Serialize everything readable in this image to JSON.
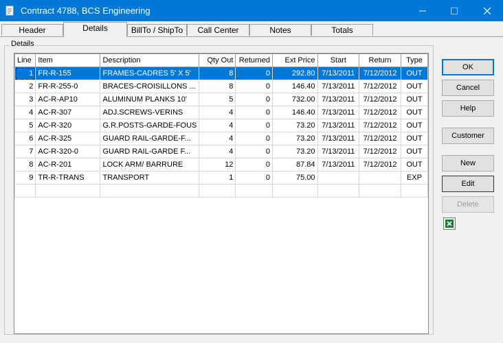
{
  "window": {
    "title": "Contract 4788, BCS Engineering"
  },
  "tabs": [
    {
      "label": "Header",
      "active": false
    },
    {
      "label": "Details",
      "active": true
    },
    {
      "label": "BillTo / ShipTo",
      "active": false
    },
    {
      "label": "Call Center",
      "active": false
    },
    {
      "label": "Notes",
      "active": false
    },
    {
      "label": "Totals",
      "active": false
    }
  ],
  "details": {
    "group_label": "Details",
    "columns": [
      "Line",
      "Item",
      "Description",
      "Qty Out",
      "Returned",
      "Ext Price",
      "Start",
      "Return",
      "Type"
    ],
    "rows": [
      [
        "1",
        "FR-R-155",
        "FRAMES-CADRES  5' X 5'",
        "8",
        "0",
        "292.80",
        "7/13/2011",
        "7/12/2012",
        "OUT"
      ],
      [
        "2",
        "FR-R-255-0",
        "BRACES-CROISILLONS ...",
        "8",
        "0",
        "146.40",
        "7/13/2011",
        "7/12/2012",
        "OUT"
      ],
      [
        "3",
        "AC-R-AP10",
        "ALUMINUM PLANKS 10'",
        "5",
        "0",
        "732.00",
        "7/13/2011",
        "7/12/2012",
        "OUT"
      ],
      [
        "4",
        "AC-R-307",
        "ADJ.SCREWS-VERINS",
        "4",
        "0",
        "146.40",
        "7/13/2011",
        "7/12/2012",
        "OUT"
      ],
      [
        "5",
        "AC-R-320",
        "G.R.POSTS-GARDE-FOUS",
        "4",
        "0",
        "73.20",
        "7/13/2011",
        "7/12/2012",
        "OUT"
      ],
      [
        "6",
        "AC-R-325",
        "GUARD RAIL-GARDE-F...",
        "4",
        "0",
        "73.20",
        "7/13/2011",
        "7/12/2012",
        "OUT"
      ],
      [
        "7",
        "AC-R-320-0",
        "GUARD RAIL-GARDE F...",
        "4",
        "0",
        "73.20",
        "7/13/2011",
        "7/12/2012",
        "OUT"
      ],
      [
        "8",
        "AC-R-201",
        "LOCK ARM/ BARRURE",
        "12",
        "0",
        "87.84",
        "7/13/2011",
        "7/12/2012",
        "OUT"
      ],
      [
        "9",
        "TR-R-TRANS",
        "TRANSPORT",
        "1",
        "0",
        "75.00",
        "",
        "",
        "EXP"
      ]
    ],
    "selected_row": 0
  },
  "buttons": {
    "ok": "OK",
    "cancel": "Cancel",
    "help": "Help",
    "customer": "Customer",
    "new": "New",
    "edit": "Edit",
    "delete": "Delete"
  },
  "colors": {
    "titlebar": "#0078d7",
    "selection": "#0078d7"
  }
}
